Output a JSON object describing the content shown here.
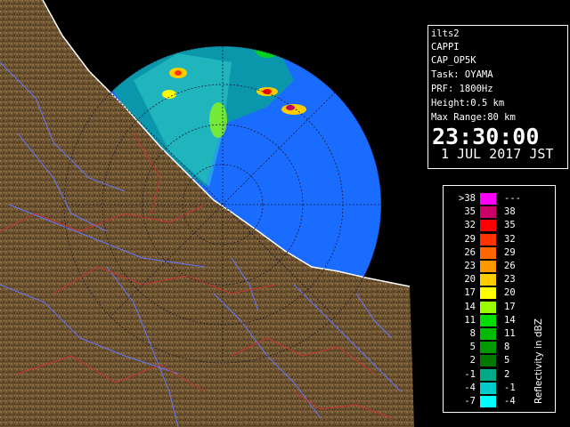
{
  "info": {
    "lines": [
      "ilts2",
      "CAPPI",
      "CAP_OP5K",
      "Task: OYAMA",
      "PRF: 1800Hz",
      "Height:0.5 km",
      "Max Range:80 km"
    ],
    "time": "23:30:00",
    "date": "1 JUL 2017 JST"
  },
  "legend": {
    "title": "Reflectivity in dBZ",
    "entries": [
      {
        "left": ">38",
        "right": "---",
        "color": "#ff00ff"
      },
      {
        "left": "35",
        "right": "38",
        "color": "#cc0066"
      },
      {
        "left": "32",
        "right": "35",
        "color": "#ff0000"
      },
      {
        "left": "29",
        "right": "32",
        "color": "#ff3300"
      },
      {
        "left": "26",
        "right": "29",
        "color": "#ff6600"
      },
      {
        "left": "23",
        "right": "26",
        "color": "#ff9900"
      },
      {
        "left": "20",
        "right": "23",
        "color": "#ffcc00"
      },
      {
        "left": "17",
        "right": "20",
        "color": "#ffff00"
      },
      {
        "left": "14",
        "right": "17",
        "color": "#99ff00"
      },
      {
        "left": "11",
        "right": "14",
        "color": "#00dd00"
      },
      {
        "left": "8",
        "right": "11",
        "color": "#00bb00"
      },
      {
        "left": "5",
        "right": "8",
        "color": "#009900"
      },
      {
        "left": "2",
        "right": "5",
        "color": "#007700"
      },
      {
        "left": "-1",
        "right": "2",
        "color": "#00aa88"
      },
      {
        "left": "-4",
        "right": "-1",
        "color": "#00cccc"
      },
      {
        "left": "-7",
        "right": "-4",
        "color": "#00ffff"
      }
    ]
  },
  "colors": {
    "sea_echo": "#1a6cff",
    "land": "#6b5230",
    "land_light": "#9a7a4e",
    "coast_line": "#ffffff",
    "rivers": "#6677ff",
    "boundaries": "#cc3333",
    "range_rings": "#222244"
  }
}
